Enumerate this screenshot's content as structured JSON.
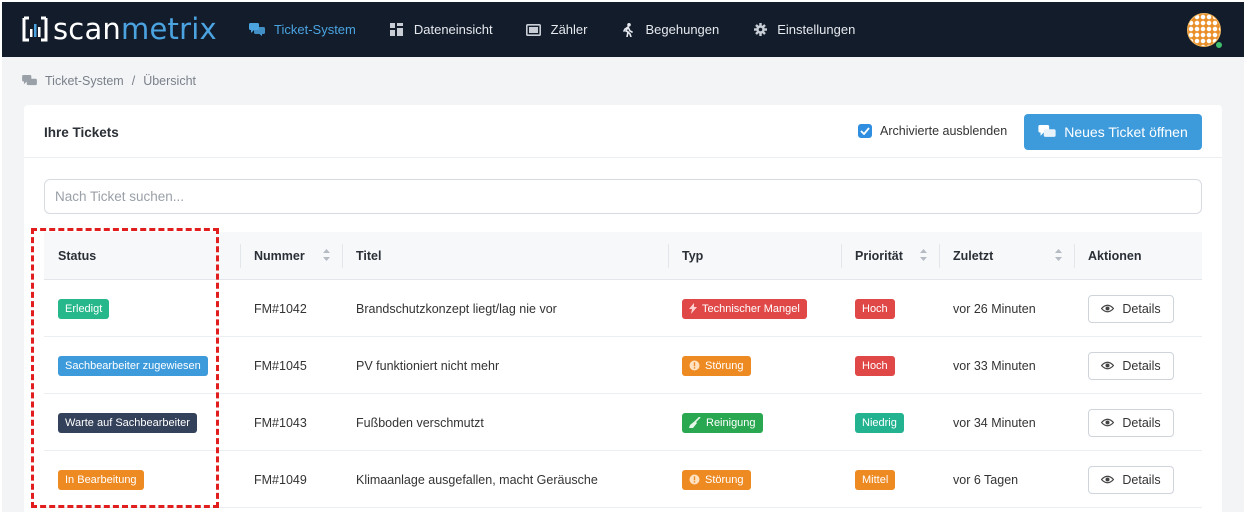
{
  "app": {
    "logo_scan": "scan",
    "logo_metrix": "metrix"
  },
  "nav": {
    "items": [
      {
        "label": "Ticket-System",
        "icon": "comments-icon",
        "active": true
      },
      {
        "label": "Dateneinsicht",
        "icon": "grid-icon",
        "active": false
      },
      {
        "label": "Zähler",
        "icon": "monitor-icon",
        "active": false
      },
      {
        "label": "Begehungen",
        "icon": "walking-icon",
        "active": false
      },
      {
        "label": "Einstellungen",
        "icon": "gear-icon",
        "active": false
      }
    ]
  },
  "breadcrumb": {
    "root": "Ticket-System",
    "separator": "/",
    "current": "Übersicht"
  },
  "card": {
    "title": "Ihre Tickets",
    "archive_checkbox_label": "Archivierte ausblenden",
    "archive_checked": true,
    "new_ticket_label": "Neues Ticket öffnen",
    "search_placeholder": "Nach Ticket suchen..."
  },
  "table": {
    "columns": [
      "Status",
      "Nummer",
      "Titel",
      "Typ",
      "Priorität",
      "Zuletzt",
      "Aktionen"
    ],
    "details_label": "Details",
    "rows": [
      {
        "status": "Erledigt",
        "status_color": "#26b88a",
        "nummer": "FM#1042",
        "titel": "Brandschutzkonzept liegt/lag nie vor",
        "typ": "Technischer Mangel",
        "typ_icon": "bolt-icon",
        "typ_color": "#e04848",
        "prio": "Hoch",
        "prio_color": "#e04848",
        "zuletzt": "vor 26 Minuten"
      },
      {
        "status": "Sachbearbeiter zugewiesen",
        "status_color": "#3d9bdc",
        "nummer": "FM#1045",
        "titel": "PV funktioniert nicht mehr",
        "typ": "Störung",
        "typ_icon": "info-icon",
        "typ_color": "#ee8a22",
        "prio": "Hoch",
        "prio_color": "#e04848",
        "zuletzt": "vor 33 Minuten"
      },
      {
        "status": "Warte auf Sachbearbeiter",
        "status_color": "#34415a",
        "nummer": "FM#1043",
        "titel": "Fußboden verschmutzt",
        "typ": "Reinigung",
        "typ_icon": "broom-icon",
        "typ_color": "#2aa851",
        "prio": "Niedrig",
        "prio_color": "#24b391",
        "zuletzt": "vor 34 Minuten"
      },
      {
        "status": "In Bearbeitung",
        "status_color": "#ee8a22",
        "nummer": "FM#1049",
        "titel": "Klimaanlage ausgefallen, macht Geräusche",
        "typ": "Störung",
        "typ_icon": "info-icon",
        "typ_color": "#ee8a22",
        "prio": "Mittel",
        "prio_color": "#ee8a22",
        "zuletzt": "vor 6 Tagen"
      }
    ]
  }
}
